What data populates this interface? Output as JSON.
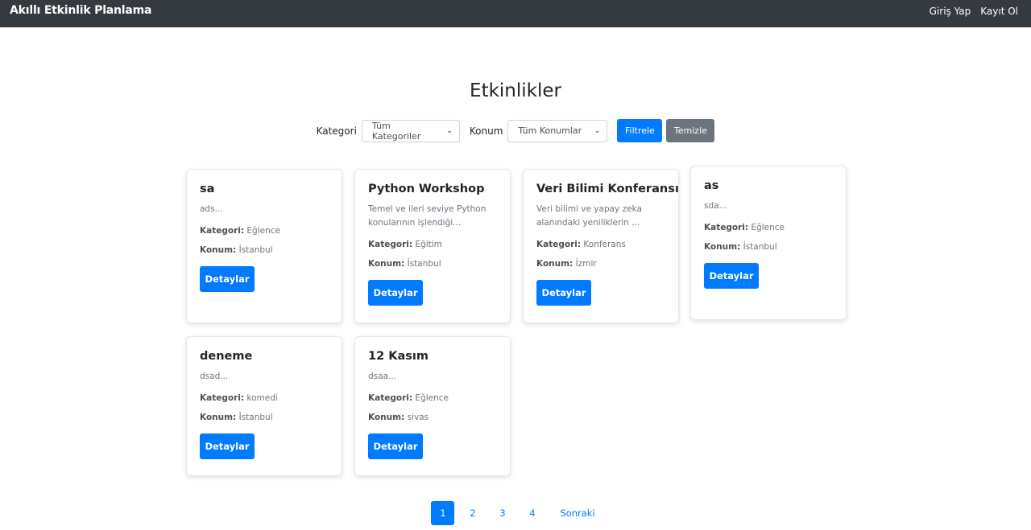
{
  "nav": {
    "brand": "Akıllı Etkinlik Planlama",
    "login": "Giriş Yap",
    "register": "Kayıt Ol"
  },
  "page": {
    "title": "Etkinlikler"
  },
  "filters": {
    "category_label": "Kategori",
    "category_selected": "Tüm Kategoriler",
    "location_label": "Konum",
    "location_selected": "Tüm Konumlar",
    "filter_button": "Filtrele",
    "clear_button": "Temizle"
  },
  "field_labels": {
    "category": "Kategori:",
    "location": "Konum:"
  },
  "details_label": "Detaylar",
  "events": [
    {
      "title": "sa",
      "description": "ads...",
      "category": "Eğlence",
      "location": "İstanbul"
    },
    {
      "title": "Python Workshop",
      "description": "Temel ve ileri seviye Python konularının işlendiği...",
      "category": "Eğitim",
      "location": "İstanbul"
    },
    {
      "title": "Veri Bilimi Konferansı",
      "description": "Veri bilimi ve yapay zeka alanındaki yeniliklerin ...",
      "category": "Konferans",
      "location": "İzmir"
    },
    {
      "title": "as",
      "description": "sda...",
      "category": "Eğlence",
      "location": "İstanbul"
    },
    {
      "title": "deneme",
      "description": "dsad...",
      "category": "komedi",
      "location": "İstanbul"
    },
    {
      "title": "12 Kasım",
      "description": "dsaa...",
      "category": "Eğlence",
      "location": "sivas"
    }
  ],
  "pagination": {
    "pages": [
      "1",
      "2",
      "3",
      "4"
    ],
    "current": "1",
    "next": "Sonraki"
  },
  "colors": {
    "navbar": "#343a40",
    "primary": "#007bff",
    "secondary": "#6c757d"
  }
}
